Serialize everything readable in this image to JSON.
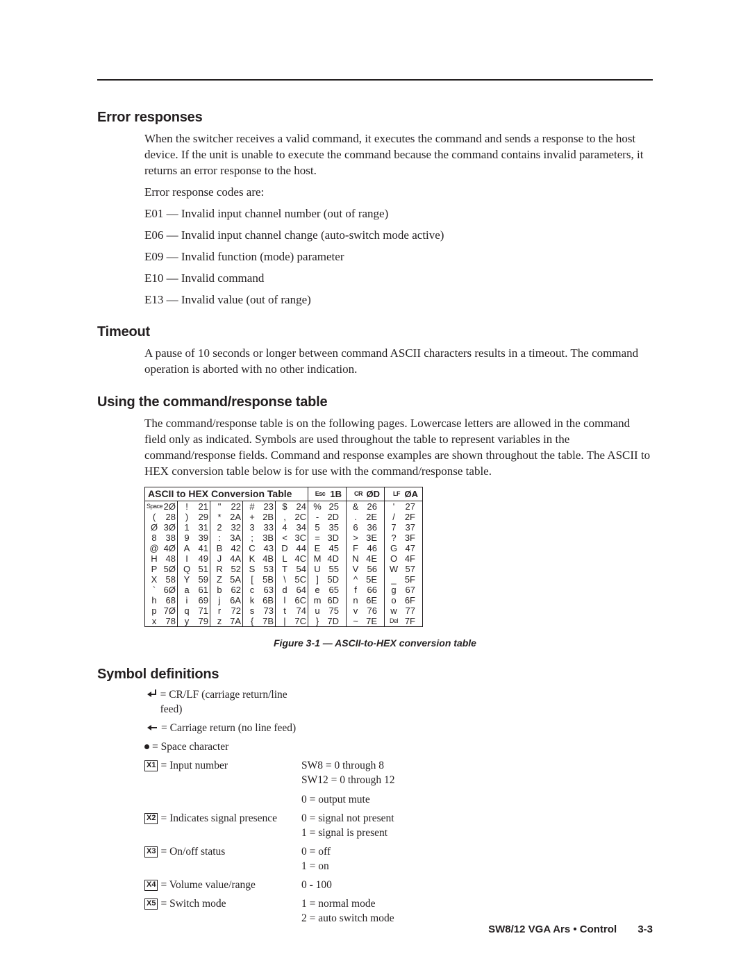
{
  "sections": {
    "error": {
      "title": "Error responses",
      "intro": "When the switcher receives a valid command, it executes the command and sends a response to the host device.  If the unit is unable to execute the command because the command contains invalid parameters, it returns an error response to the host.",
      "codes_intro": "Error response codes are:",
      "codes": [
        "E01 — Invalid input channel number (out of range)",
        "E06 — Invalid input channel change (auto-switch mode active)",
        "E09 — Invalid function (mode) parameter",
        "E10 — Invalid command",
        "E13 — Invalid value (out of range)"
      ]
    },
    "timeout": {
      "title": "Timeout",
      "body": "A pause of 10 seconds or longer between command ASCII characters results in a timeout.  The command operation is aborted with no other indication."
    },
    "cmdresp": {
      "title": "Using the command/response table",
      "body": "The command/response table is on the following pages.  Lowercase letters are allowed in the command field only as indicated.  Symbols are used throughout the table to represent variables in the command/response fields.  Command and response examples are shown throughout the table.  The ASCII to HEX conversion table below is for use with the command/response table."
    },
    "symdef": {
      "title": "Symbol definitions"
    }
  },
  "hex_table": {
    "title": "ASCII to HEX  Conversion Table",
    "header_right": [
      {
        "ch": "Esc",
        "hx": "1B",
        "small": true
      },
      {
        "ch": "CR",
        "hx": "ØD",
        "small": true
      },
      {
        "ch": "LF",
        "hx": "ØA",
        "small": true
      }
    ],
    "rows": [
      [
        {
          "ch": "Space",
          "hx": "2Ø",
          "small": true
        },
        {
          "ch": "!",
          "hx": "21"
        },
        {
          "ch": "\"",
          "hx": "22"
        },
        {
          "ch": "#",
          "hx": "23"
        },
        {
          "ch": "$",
          "hx": "24"
        },
        {
          "ch": "%",
          "hx": "25"
        },
        {
          "ch": "&",
          "hx": "26"
        },
        {
          "ch": "'",
          "hx": "27"
        }
      ],
      [
        {
          "ch": "(",
          "hx": "28"
        },
        {
          "ch": ")",
          "hx": "29"
        },
        {
          "ch": "*",
          "hx": "2A"
        },
        {
          "ch": "+",
          "hx": "2B"
        },
        {
          "ch": ",",
          "hx": "2C"
        },
        {
          "ch": "-",
          "hx": "2D"
        },
        {
          "ch": ".",
          "hx": "2E"
        },
        {
          "ch": "/",
          "hx": "2F"
        }
      ],
      [
        {
          "ch": "Ø",
          "hx": "3Ø"
        },
        {
          "ch": "1",
          "hx": "31"
        },
        {
          "ch": "2",
          "hx": "32"
        },
        {
          "ch": "3",
          "hx": "33"
        },
        {
          "ch": "4",
          "hx": "34"
        },
        {
          "ch": "5",
          "hx": "35"
        },
        {
          "ch": "6",
          "hx": "36"
        },
        {
          "ch": "7",
          "hx": "37"
        }
      ],
      [
        {
          "ch": "8",
          "hx": "38"
        },
        {
          "ch": "9",
          "hx": "39"
        },
        {
          "ch": ":",
          "hx": "3A"
        },
        {
          "ch": ";",
          "hx": "3B"
        },
        {
          "ch": "<",
          "hx": "3C"
        },
        {
          "ch": "=",
          "hx": "3D"
        },
        {
          "ch": ">",
          "hx": "3E"
        },
        {
          "ch": "?",
          "hx": "3F"
        }
      ],
      [
        {
          "ch": "@",
          "hx": "4Ø"
        },
        {
          "ch": "A",
          "hx": "41"
        },
        {
          "ch": "B",
          "hx": "42"
        },
        {
          "ch": "C",
          "hx": "43"
        },
        {
          "ch": "D",
          "hx": "44"
        },
        {
          "ch": "E",
          "hx": "45"
        },
        {
          "ch": "F",
          "hx": "46"
        },
        {
          "ch": "G",
          "hx": "47"
        }
      ],
      [
        {
          "ch": "H",
          "hx": "48"
        },
        {
          "ch": "I",
          "hx": "49"
        },
        {
          "ch": "J",
          "hx": "4A"
        },
        {
          "ch": "K",
          "hx": "4B"
        },
        {
          "ch": "L",
          "hx": "4C"
        },
        {
          "ch": "M",
          "hx": "4D"
        },
        {
          "ch": "N",
          "hx": "4E"
        },
        {
          "ch": "O",
          "hx": "4F"
        }
      ],
      [
        {
          "ch": "P",
          "hx": "5Ø"
        },
        {
          "ch": "Q",
          "hx": "51"
        },
        {
          "ch": "R",
          "hx": "52"
        },
        {
          "ch": "S",
          "hx": "53"
        },
        {
          "ch": "T",
          "hx": "54"
        },
        {
          "ch": "U",
          "hx": "55"
        },
        {
          "ch": "V",
          "hx": "56"
        },
        {
          "ch": "W",
          "hx": "57"
        }
      ],
      [
        {
          "ch": "X",
          "hx": "58"
        },
        {
          "ch": "Y",
          "hx": "59"
        },
        {
          "ch": "Z",
          "hx": "5A"
        },
        {
          "ch": "[",
          "hx": "5B"
        },
        {
          "ch": "\\",
          "hx": "5C"
        },
        {
          "ch": "]",
          "hx": "5D"
        },
        {
          "ch": "^",
          "hx": "5E"
        },
        {
          "ch": "_",
          "hx": "5F"
        }
      ],
      [
        {
          "ch": "`",
          "hx": "6Ø"
        },
        {
          "ch": "a",
          "hx": "61"
        },
        {
          "ch": "b",
          "hx": "62"
        },
        {
          "ch": "c",
          "hx": "63"
        },
        {
          "ch": "d",
          "hx": "64"
        },
        {
          "ch": "e",
          "hx": "65"
        },
        {
          "ch": "f",
          "hx": "66"
        },
        {
          "ch": "g",
          "hx": "67"
        }
      ],
      [
        {
          "ch": "h",
          "hx": "68"
        },
        {
          "ch": "i",
          "hx": "69"
        },
        {
          "ch": "j",
          "hx": "6A"
        },
        {
          "ch": "k",
          "hx": "6B"
        },
        {
          "ch": "l",
          "hx": "6C"
        },
        {
          "ch": "m",
          "hx": "6D"
        },
        {
          "ch": "n",
          "hx": "6E"
        },
        {
          "ch": "o",
          "hx": "6F"
        }
      ],
      [
        {
          "ch": "p",
          "hx": "7Ø"
        },
        {
          "ch": "q",
          "hx": "71"
        },
        {
          "ch": "r",
          "hx": "72"
        },
        {
          "ch": "s",
          "hx": "73"
        },
        {
          "ch": "t",
          "hx": "74"
        },
        {
          "ch": "u",
          "hx": "75"
        },
        {
          "ch": "v",
          "hx": "76"
        },
        {
          "ch": "w",
          "hx": "77"
        }
      ],
      [
        {
          "ch": "x",
          "hx": "78"
        },
        {
          "ch": "y",
          "hx": "79"
        },
        {
          "ch": "z",
          "hx": "7A"
        },
        {
          "ch": "{",
          "hx": "7B"
        },
        {
          "ch": "|",
          "hx": "7C"
        },
        {
          "ch": "}",
          "hx": "7D"
        },
        {
          "ch": "~",
          "hx": "7E"
        },
        {
          "ch": "Del",
          "hx": "7F",
          "small": true
        }
      ]
    ]
  },
  "figure_caption": "Figure 3-1 — ASCII-to-HEX conversion table",
  "symbols": [
    {
      "type": "crlf",
      "desc": "= CR/LF (carriage return/line feed)",
      "vals": ""
    },
    {
      "type": "cr",
      "desc": "= Carriage return (no line feed)",
      "vals": ""
    },
    {
      "type": "dot",
      "desc": "= Space character",
      "vals": ""
    },
    {
      "type": "box",
      "box": "X1",
      "desc": " = Input number",
      "vals": "SW8 = 0 through 8\nSW12 = 0 through 12\n\n0 = output mute"
    },
    {
      "type": "box",
      "box": "X2",
      "desc": " = Indicates signal presence",
      "vals": "0 = signal not present\n1 = signal is present"
    },
    {
      "type": "box",
      "box": "X3",
      "desc": " = On/off status",
      "vals": "0 = off\n1 = on"
    },
    {
      "type": "box",
      "box": "X4",
      "desc": " = Volume value/range",
      "vals": "0 - 100"
    },
    {
      "type": "box",
      "box": "X5",
      "desc": " = Switch mode",
      "vals": "1 = normal mode\n2 = auto switch mode"
    }
  ],
  "footer": {
    "text": "SW8/12 VGA Ars • Control",
    "page": "3-3"
  }
}
